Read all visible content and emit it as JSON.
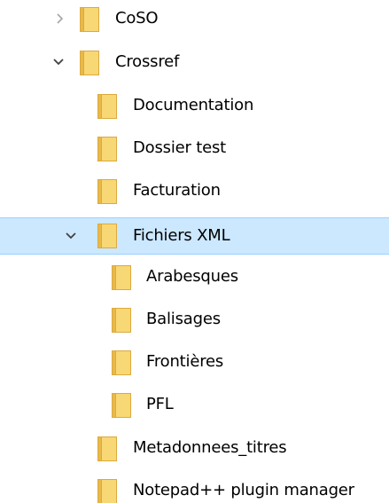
{
  "tree": {
    "rows": [
      {
        "label": "CoSO",
        "chevron": "collapsed"
      },
      {
        "label": "Crossref",
        "chevron": "expanded"
      },
      {
        "label": "Documentation",
        "chevron": "none"
      },
      {
        "label": "Dossier test",
        "chevron": "none"
      },
      {
        "label": "Facturation",
        "chevron": "none"
      },
      {
        "label": "Fichiers XML",
        "chevron": "expanded",
        "selected": true
      },
      {
        "label": "Arabesques",
        "chevron": "none"
      },
      {
        "label": "Balisages",
        "chevron": "none"
      },
      {
        "label": "Frontières",
        "chevron": "none"
      },
      {
        "label": "PFL",
        "chevron": "none"
      },
      {
        "label": "Metadonnees_titres",
        "chevron": "none"
      },
      {
        "label": "Notepad++ plugin manager",
        "chevron": "none"
      }
    ]
  },
  "colors": {
    "folder_fill": "#f8d775",
    "folder_edge": "#dcaa3f",
    "selection_bg": "#cce8ff",
    "selection_border": "#99d1ff",
    "chevron_collapsed": "#a6a6a6",
    "chevron_expanded": "#404040"
  }
}
